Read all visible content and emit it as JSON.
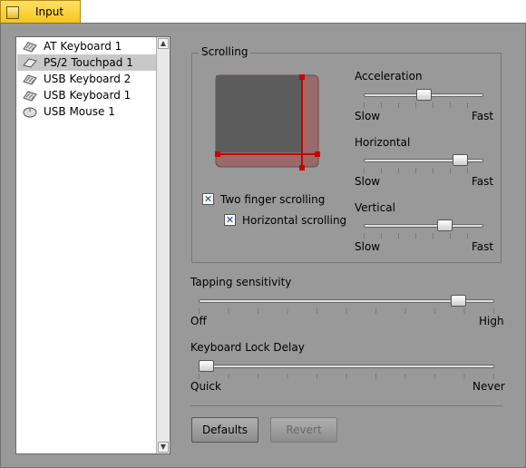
{
  "tab": {
    "title": "Input"
  },
  "devices": [
    {
      "label": "AT Keyboard 1",
      "icon": "keyboard-icon"
    },
    {
      "label": "PS/2 Touchpad 1",
      "icon": "touchpad-icon",
      "selected": true
    },
    {
      "label": "USB Keyboard 2",
      "icon": "keyboard-icon"
    },
    {
      "label": "USB Keyboard 1",
      "icon": "keyboard-icon"
    },
    {
      "label": "USB Mouse 1",
      "icon": "mouse-icon"
    }
  ],
  "scrolling": {
    "title": "Scrolling",
    "two_finger": {
      "label": "Two finger scrolling",
      "checked": true
    },
    "horizontal_scroll": {
      "label": "Horizontal scrolling",
      "checked": true
    },
    "acceleration": {
      "label": "Acceleration",
      "min": "Slow",
      "max": "Fast",
      "value": 0.5
    },
    "horizontal": {
      "label": "Horizontal",
      "min": "Slow",
      "max": "Fast",
      "value": 0.85
    },
    "vertical": {
      "label": "Vertical",
      "min": "Slow",
      "max": "Fast",
      "value": 0.7
    }
  },
  "tapping": {
    "label": "Tapping sensitivity",
    "min": "Off",
    "max": "High",
    "value": 0.9
  },
  "keylock": {
    "label": "Keyboard Lock Delay",
    "min": "Quick",
    "max": "Never",
    "value": 0.0
  },
  "buttons": {
    "defaults": "Defaults",
    "revert": "Revert"
  },
  "colors": {
    "accent_red": "#cc0000",
    "window_bg": "#999999",
    "tab_gold": "#f5c518"
  }
}
